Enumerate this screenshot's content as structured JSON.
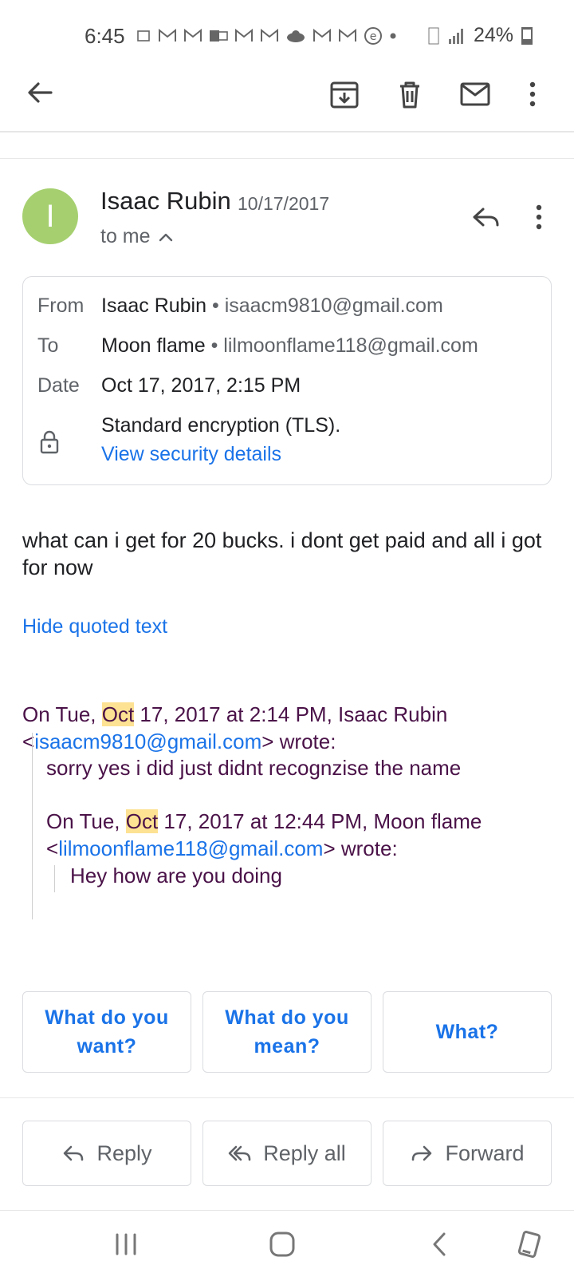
{
  "status_bar": {
    "time": "6:45",
    "battery": "24%"
  },
  "sender": {
    "avatar_letter": "I",
    "name": "Isaac Rubin",
    "date": "10/17/2017",
    "recipient_summary": "to me"
  },
  "details": {
    "from_label": "From",
    "from_name": "Isaac Rubin",
    "from_email": "isaacm9810@gmail.com",
    "to_label": "To",
    "to_name": "Moon flame",
    "to_email": "lilmoonflame118@gmail.com",
    "date_label": "Date",
    "date_value": "Oct 17, 2017, 2:15 PM",
    "encryption": "Standard encryption (TLS).",
    "security_link": "View security details"
  },
  "body": {
    "text": "what can i get for 20 bucks. i dont get paid and all i got for now",
    "hide_quoted": "Hide quoted text"
  },
  "quote": {
    "header_prefix": "On Tue, ",
    "header_month": "Oct",
    "header_suffix": " 17, 2017 at 2:14 PM, Isaac Rubin",
    "header_email": "isaacm9810@gmail.com",
    "header_wrote": "> wrote:",
    "text": "sorry yes i did just didnt recognzise the name",
    "nested_prefix": "On Tue, ",
    "nested_month": "Oct",
    "nested_suffix": " 17, 2017 at 12:44 PM, Moon flame",
    "nested_email": "lilmoonflame118@gmail.com",
    "nested_wrote": "> wrote:",
    "nested_text": "Hey how are you doing"
  },
  "smart_replies": [
    "What do you want?",
    "What do you mean?",
    "What?"
  ],
  "actions": {
    "reply": "Reply",
    "reply_all": "Reply all",
    "forward": "Forward"
  }
}
